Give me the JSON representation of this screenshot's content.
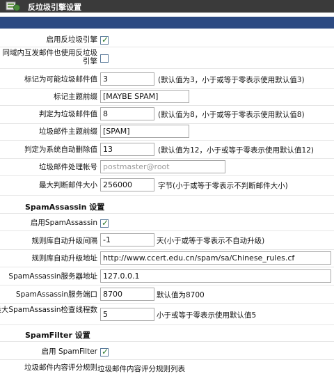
{
  "header": {
    "title": "反垃圾引擎设置"
  },
  "form": {
    "enable_antispam": {
      "label": "启用反垃圾引擎",
      "checked": true
    },
    "same_domain": {
      "label": "同域内互发邮件也使用反垃圾引擎",
      "checked": false
    },
    "mark_possible": {
      "label": "标记为可能垃圾邮件值",
      "value": "3",
      "hint": "(默认值为3，小于或等于零表示使用默认值3)"
    },
    "subject_prefix": {
      "label": "标记主题前缀",
      "value": "[MAYBE SPAM]"
    },
    "mark_spam": {
      "label": "判定为垃圾邮件值",
      "value": "8",
      "hint": "(默认值为8，小于或等于零表示使用默认值8)"
    },
    "spam_subject_prefix": {
      "label": "垃圾邮件主题前缀",
      "value": "[SPAM]"
    },
    "auto_delete": {
      "label": "判定为系统自动删除值",
      "value": "13",
      "hint": "(默认值为12，小于或等于零表示使用默认值12)"
    },
    "spam_account": {
      "label": "垃圾邮件处理帐号",
      "value": "postmaster@root"
    },
    "max_size": {
      "label": "最大判断邮件大小",
      "value": "256000",
      "hint": "字节(小于或等于零表示不判断邮件大小)"
    }
  },
  "spamassassin": {
    "section_title": "SpamAssassin 设置",
    "enable": {
      "label": "启用SpamAssassin",
      "checked": true
    },
    "update_interval": {
      "label": "规则库自动升级间隔",
      "value": "-1",
      "hint": "天(小于或等于零表示不自动升级)"
    },
    "update_url": {
      "label": "规则库自动升级地址",
      "value": "http://www.ccert.edu.cn/spam/sa/Chinese_rules.cf"
    },
    "server_addr": {
      "label": "SpamAssassin服务器地址",
      "value": "127.0.0.1"
    },
    "server_port": {
      "label": "SpamAssassin服务端口",
      "value": "8700",
      "hint": "默认值为8700"
    },
    "max_threads": {
      "label": "最大SpamAssassin检查线程数",
      "value": "5",
      "hint": "小于或等于零表示使用默认值5"
    }
  },
  "spamfilter": {
    "section_title": "SpamFilter 设置",
    "enable": {
      "label": "启用 SpamFilter",
      "checked": true
    },
    "rules": {
      "label": "垃圾邮件内容评分规则",
      "value": "垃圾邮件内容评分规则列表"
    }
  },
  "icons": {
    "header_logo": "settings-app-icon",
    "check": "✓"
  },
  "colors": {
    "titlebar": "#3a3a3a",
    "bluebar": "#2c4a82",
    "check": "#2a7a2a"
  }
}
